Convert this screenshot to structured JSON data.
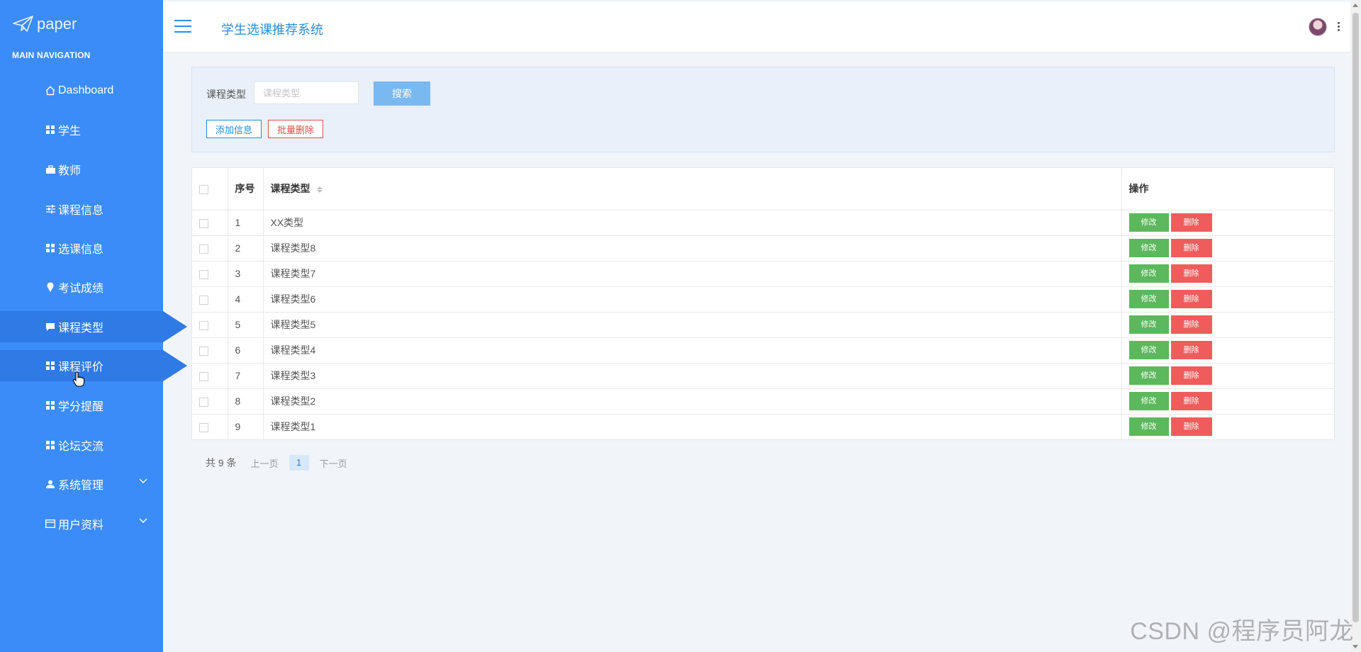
{
  "logo": {
    "text": "paper"
  },
  "sidebar": {
    "header": "MAIN NAVIGATION",
    "items": [
      {
        "label": "Dashboard",
        "icon": "home-icon"
      },
      {
        "label": "学生",
        "icon": "grid-icon"
      },
      {
        "label": "教师",
        "icon": "briefcase-icon"
      },
      {
        "label": "课程信息",
        "icon": "sliders-icon"
      },
      {
        "label": "选课信息",
        "icon": "grid-icon"
      },
      {
        "label": "考试成绩",
        "icon": "pin-icon"
      },
      {
        "label": "课程类型",
        "icon": "chat-icon",
        "active": true
      },
      {
        "label": "课程评价",
        "icon": "grid-icon",
        "active": true
      },
      {
        "label": "学分提醒",
        "icon": "grid-icon"
      },
      {
        "label": "论坛交流",
        "icon": "grid-icon"
      },
      {
        "label": "系统管理",
        "icon": "user-icon",
        "expandable": true
      },
      {
        "label": "用户资料",
        "icon": "card-icon",
        "expandable": true
      }
    ]
  },
  "header": {
    "title": "学生选课推荐系统"
  },
  "search": {
    "label": "课程类型",
    "placeholder": "课程类型",
    "value": "",
    "button": "搜索"
  },
  "actions": {
    "add": "添加信息",
    "batch_delete": "批量删除"
  },
  "table": {
    "columns": [
      "序号",
      "课程类型",
      "操作"
    ],
    "edit_label": "修改",
    "delete_label": "删除",
    "rows": [
      {
        "no": "1",
        "type": "XX类型"
      },
      {
        "no": "2",
        "type": "课程类型8"
      },
      {
        "no": "3",
        "type": "课程类型7"
      },
      {
        "no": "4",
        "type": "课程类型6"
      },
      {
        "no": "5",
        "type": "课程类型5"
      },
      {
        "no": "6",
        "type": "课程类型4"
      },
      {
        "no": "7",
        "type": "课程类型3"
      },
      {
        "no": "8",
        "type": "课程类型2"
      },
      {
        "no": "9",
        "type": "课程类型1"
      }
    ]
  },
  "pager": {
    "total": "共 9 条",
    "prev": "上一页",
    "page": "1",
    "next": "下一页"
  },
  "watermark": "CSDN @程序员阿龙",
  "colors": {
    "sidebar": "#3b8cf7",
    "sidebar_active": "#2f7ae4",
    "edit": "#5cb85c",
    "delete": "#f05c5c",
    "search_button": "#7ab8f0",
    "title": "#2b8ed9"
  }
}
